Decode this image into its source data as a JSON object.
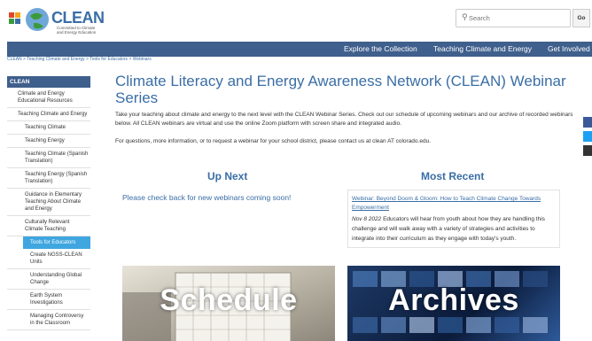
{
  "logo": {
    "word": "CLEAN",
    "tagline": "Committed to Climate and Energy Education"
  },
  "search": {
    "placeholder": "Search",
    "go_label": "Go"
  },
  "nav": {
    "items": [
      "Explore the Collection",
      "Teaching Climate and Energy",
      "Get Involved"
    ]
  },
  "breadcrumb": "CLEAN > Teaching Climate and Energy > Tools for Educators > Webinars",
  "sidebar": {
    "heading": "CLEAN",
    "items": [
      "Climate and Energy Educational Resources",
      "Teaching Climate and Energy",
      "Teaching Climate",
      "Teaching Energy",
      "Teaching Climate (Spanish Translation)",
      "Teaching Energy (Spanish Translation)",
      "Guidance in Elementary Teaching About Climate and Energy",
      "Culturally Relevant Climate Teaching",
      "Tools for Educators",
      "Create NGSS-CLEAN Units",
      "Understanding Global Change",
      "Earth System Investigations",
      "Managing Controversy in the Classroom"
    ]
  },
  "main": {
    "title": "Climate Literacy and Energy Awareness Network (CLEAN) Webinar Series",
    "intro": "Take your teaching about climate and energy to the next level with the CLEAN Webinar Series. Check out our schedule of upcoming webinars and our archive of recorded webinars below. All CLEAN webinars are virtual and use the online Zoom platform with screen share and integrated audio.",
    "contact": "For questions, more information, or to request a webinar for your school district, please contact us at clean AT colorado.edu.",
    "up_next_heading": "Up Next",
    "up_next_text": "Please check back for new webinars coming soon!",
    "most_recent_heading": "Most Recent",
    "recent": {
      "link": "Webinar: Beyond Doom & Gloom: How to Teach Climate Change Towards Empowerment",
      "date": "Nov 8 2022",
      "description": "Educators will hear from youth about how they are handling this challenge and will walk away with a variety of strategies and activities to integrate into their curriculum as they engage with today's youth."
    },
    "tiles": {
      "schedule": "Schedule",
      "archives": "Archives"
    }
  },
  "colors": {
    "nav": "#3f5f8c",
    "accent": "#3a6ea5",
    "sidebar_active": "#3fa6e0"
  },
  "icons": [
    "globe-logo-icon",
    "search-icon",
    "facebook-icon",
    "twitter-icon",
    "share-icon"
  ]
}
